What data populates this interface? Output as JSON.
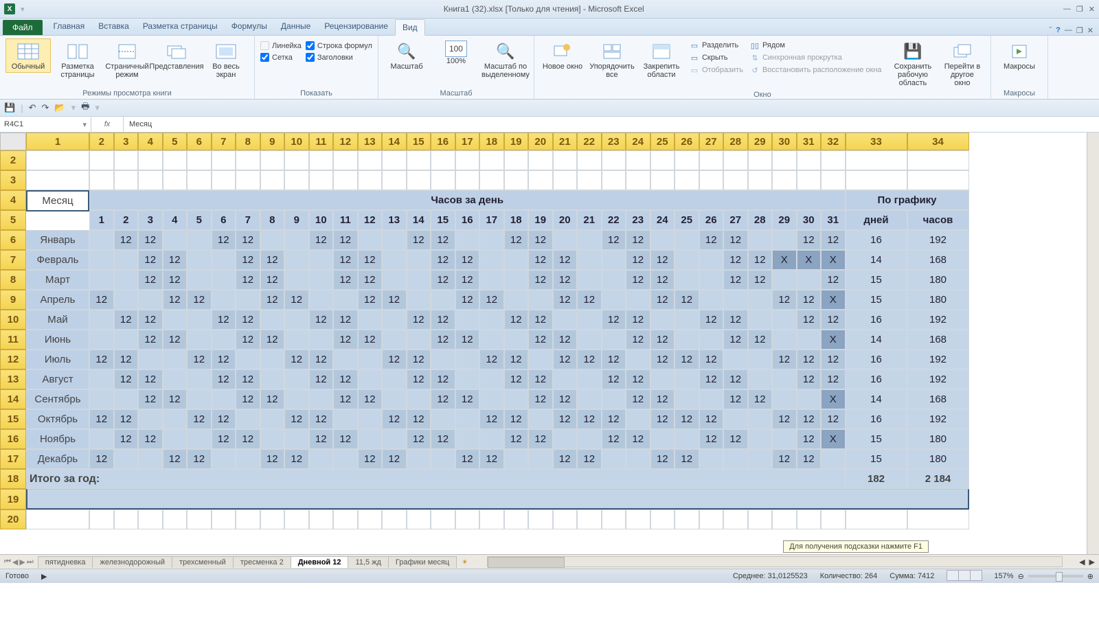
{
  "title": "Книга1 (32).xlsx  [Только для чтения]  -  Microsoft Excel",
  "tabs": {
    "file": "Файл",
    "items": [
      "Главная",
      "Вставка",
      "Разметка страницы",
      "Формулы",
      "Данные",
      "Рецензирование",
      "Вид"
    ],
    "active": 6
  },
  "ribbon": {
    "views": {
      "label": "Режимы просмотра книги",
      "normal": "Обычный",
      "layout": "Разметка\nстраницы",
      "pagebreak": "Страничный\nрежим",
      "custom": "Представления",
      "full": "Во весь\nэкран"
    },
    "show": {
      "label": "Показать",
      "ruler": "Линейка",
      "formula": "Строка формул",
      "grid": "Сетка",
      "headings": "Заголовки"
    },
    "zoom": {
      "label": "Масштаб",
      "zoom": "Масштаб",
      "p100": "100%",
      "sel": "Масштаб по\nвыделенному"
    },
    "window": {
      "label": "Окно",
      "neww": "Новое\nокно",
      "arrange": "Упорядочить\nвсе",
      "freeze": "Закрепить\nобласти",
      "split": "Разделить",
      "hide": "Скрыть",
      "unhide": "Отобразить",
      "side": "Рядом",
      "sync": "Синхронная прокрутка",
      "reset": "Восстановить расположение окна",
      "save": "Сохранить\nрабочую область",
      "switch": "Перейти в\nдругое окно"
    },
    "macros": {
      "label": "Макросы",
      "btn": "Макросы"
    }
  },
  "namebox": "R4C1",
  "formula": "Месяц",
  "colheaders": [
    "1",
    "2",
    "3",
    "4",
    "5",
    "6",
    "7",
    "8",
    "9",
    "10",
    "11",
    "12",
    "13",
    "14",
    "15",
    "16",
    "17",
    "18",
    "19",
    "20",
    "21",
    "22",
    "23",
    "24",
    "25",
    "26",
    "27",
    "28",
    "29",
    "30",
    "31",
    "32",
    "33",
    "34"
  ],
  "rowheaders": [
    "2",
    "3",
    "4",
    "5",
    "6",
    "7",
    "8",
    "9",
    "10",
    "11",
    "12",
    "13",
    "14",
    "15",
    "16",
    "17",
    "18",
    "19",
    "20"
  ],
  "table": {
    "month_hdr": "Месяц",
    "hours_hdr": "Часов за день",
    "schedule_hdr": "По графику",
    "days_hdr": "1,2,3,4,5,6,7,8,9,10,11,12,13,14,15,16,17,18,19,20,21,22,23,24,25,26,27,28,29,30,31",
    "col_days": "дней",
    "col_hours": "часов",
    "months": [
      "Январь",
      "Февраль",
      "Март",
      "Апрель",
      "Май",
      "Июнь",
      "Июль",
      "Август",
      "Сентябрь",
      "Октябрь",
      "Ноябрь",
      "Декабрь"
    ],
    "schedule": [
      [
        ".",
        "12",
        "12",
        ".",
        ".",
        "12",
        "12",
        ".",
        ".",
        "12",
        "12",
        ".",
        ".",
        "12",
        "12",
        ".",
        ".",
        "12",
        "12",
        ".",
        ".",
        "12",
        "12",
        ".",
        ".",
        "12",
        "12",
        ".",
        ".",
        "12",
        "12"
      ],
      [
        ".",
        ".",
        "12",
        "12",
        ".",
        ".",
        "12",
        "12",
        ".",
        ".",
        "12",
        "12",
        ".",
        ".",
        "12",
        "12",
        ".",
        ".",
        "12",
        "12",
        ".",
        ".",
        "12",
        "12",
        ".",
        ".",
        "12",
        "12",
        "X",
        "X",
        "X"
      ],
      [
        ".",
        ".",
        "12",
        "12",
        ".",
        ".",
        "12",
        "12",
        ".",
        ".",
        "12",
        "12",
        ".",
        ".",
        "12",
        "12",
        ".",
        ".",
        "12",
        "12",
        ".",
        ".",
        "12",
        "12",
        ".",
        ".",
        "12",
        "12",
        ".",
        ".",
        "12"
      ],
      [
        "12",
        ".",
        ".",
        "12",
        "12",
        ".",
        ".",
        "12",
        "12",
        ".",
        ".",
        "12",
        "12",
        ".",
        ".",
        "12",
        "12",
        ".",
        ".",
        "12",
        "12",
        ".",
        ".",
        "12",
        "12",
        ".",
        ".",
        ".",
        "12",
        "12",
        "X"
      ],
      [
        ".",
        "12",
        "12",
        ".",
        ".",
        "12",
        "12",
        ".",
        ".",
        "12",
        "12",
        ".",
        ".",
        "12",
        "12",
        ".",
        ".",
        "12",
        "12",
        ".",
        ".",
        "12",
        "12",
        ".",
        ".",
        "12",
        "12",
        ".",
        ".",
        "12",
        "12"
      ],
      [
        ".",
        ".",
        "12",
        "12",
        ".",
        ".",
        "12",
        "12",
        ".",
        ".",
        "12",
        "12",
        ".",
        ".",
        "12",
        "12",
        ".",
        ".",
        "12",
        "12",
        ".",
        ".",
        "12",
        "12",
        ".",
        ".",
        "12",
        "12",
        ".",
        ".",
        "X"
      ],
      [
        "12",
        "12",
        ".",
        ".",
        "12",
        "12",
        ".",
        ".",
        "12",
        "12",
        ".",
        ".",
        "12",
        "12",
        ".",
        ".",
        "12",
        "12",
        ".",
        "12",
        "12",
        "12",
        ".",
        "12",
        "12",
        "12",
        ".",
        ".",
        "12",
        "12",
        "12"
      ],
      [
        ".",
        "12",
        "12",
        ".",
        ".",
        "12",
        "12",
        ".",
        ".",
        "12",
        "12",
        ".",
        ".",
        "12",
        "12",
        ".",
        ".",
        "12",
        "12",
        ".",
        ".",
        "12",
        "12",
        ".",
        ".",
        "12",
        "12",
        ".",
        ".",
        "12",
        "12"
      ],
      [
        ".",
        ".",
        "12",
        "12",
        ".",
        ".",
        "12",
        "12",
        ".",
        ".",
        "12",
        "12",
        ".",
        ".",
        "12",
        "12",
        ".",
        ".",
        "12",
        "12",
        ".",
        ".",
        "12",
        "12",
        ".",
        ".",
        "12",
        "12",
        ".",
        ".",
        "X"
      ],
      [
        "12",
        "12",
        ".",
        ".",
        "12",
        "12",
        ".",
        ".",
        "12",
        "12",
        ".",
        ".",
        "12",
        "12",
        ".",
        ".",
        "12",
        "12",
        ".",
        "12",
        "12",
        "12",
        ".",
        "12",
        "12",
        "12",
        ".",
        ".",
        "12",
        "12",
        "12"
      ],
      [
        ".",
        "12",
        "12",
        ".",
        ".",
        "12",
        "12",
        ".",
        ".",
        "12",
        "12",
        ".",
        ".",
        "12",
        "12",
        ".",
        ".",
        "12",
        "12",
        ".",
        ".",
        "12",
        "12",
        ".",
        ".",
        "12",
        "12",
        ".",
        ".",
        "12",
        "X"
      ],
      [
        "12",
        ".",
        ".",
        "12",
        "12",
        ".",
        ".",
        "12",
        "12",
        ".",
        ".",
        "12",
        "12",
        ".",
        ".",
        "12",
        "12",
        ".",
        ".",
        "12",
        "12",
        ".",
        ".",
        "12",
        "12",
        ".",
        ".",
        ".",
        "12",
        "12",
        "."
      ]
    ],
    "days": [
      "16",
      "14",
      "15",
      "15",
      "16",
      "14",
      "16",
      "16",
      "14",
      "16",
      "15",
      "15"
    ],
    "hours": [
      "192",
      "168",
      "180",
      "180",
      "192",
      "168",
      "192",
      "192",
      "168",
      "192",
      "180",
      "180"
    ],
    "total_label": "Итого за год:",
    "total_days": "182",
    "total_hours": "2 184"
  },
  "sheets": {
    "items": [
      "пятидневка",
      "железнодорожный",
      "трехсменный",
      "тресменка 2",
      "Дневной 12",
      "11,5 жд",
      "Графики месяц"
    ],
    "active": 4
  },
  "tooltip": "Для получения подсказки нажмите F1",
  "status": {
    "ready": "Готово",
    "avg": "Среднее: 31,0125523",
    "count": "Количество: 264",
    "sum": "Сумма: 7412",
    "zoom": "157%"
  }
}
